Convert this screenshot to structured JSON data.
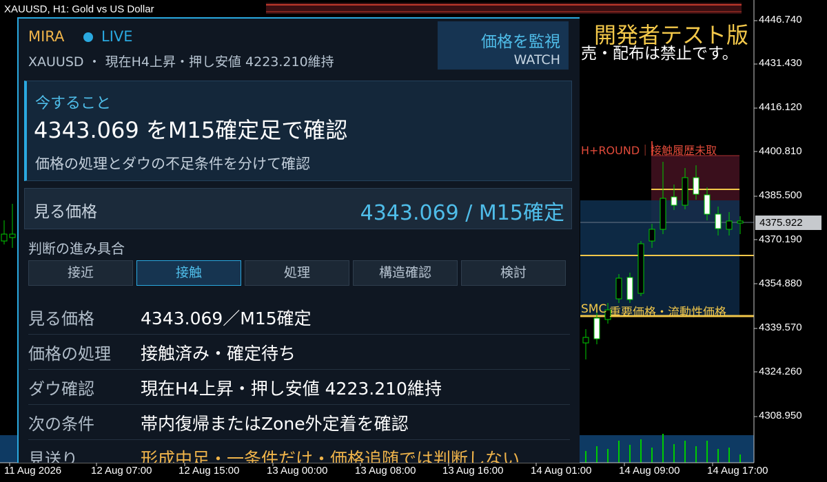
{
  "window": {
    "symbol_title": "XAUUSD, H1:  Gold vs US Dollar"
  },
  "chart": {
    "price_labels": [
      "4446.740",
      "4431.430",
      "4416.120",
      "4400.810",
      "4385.500",
      "4370.190",
      "4354.880",
      "4339.570",
      "4324.260",
      "4308.950"
    ],
    "current_price": "4375.922",
    "time_labels": [
      "11 Aug 2026",
      "12 Aug 07:00",
      "12 Aug 15:00",
      "13 Aug 00:00",
      "13 Aug 08:00",
      "13 Aug 16:00",
      "14 Aug 01:00",
      "14 Aug 09:00",
      "14 Aug 17:00"
    ],
    "dev_banner": "開発者テスト版",
    "dev_notice": "売・配布は禁止です。",
    "round_label": "H+ROUND｜接触履歴未取",
    "smc_label": "SMC",
    "liquidity_label": "重要価格・流動性価格",
    "colors": {
      "bull": "#00cc00",
      "candle_body": "#ffffff",
      "level": "#f3c84a",
      "zone": "#0f3050"
    }
  },
  "panel": {
    "brand": "MIRA",
    "status": "LIVE",
    "subtitle": "XAUUSD ・ 現在H4上昇・押し安値 4223.210維持",
    "watch_button": {
      "jp": "価格を監視",
      "en": "WATCH"
    },
    "todo": {
      "label": "今すること",
      "main": "4343.069 をM15確定足で確認",
      "sub": "価格の処理とダウの不足条件を分けて確認"
    },
    "watch_price": {
      "label": "見る価格",
      "value": "4343.069 / M15確定"
    },
    "progress": {
      "title": "判断の進み具合",
      "steps": [
        "接近",
        "接触",
        "処理",
        "構造確認",
        "検討"
      ],
      "active": "接触"
    },
    "rows": [
      {
        "key": "見る価格",
        "value": "4343.069／M15確定"
      },
      {
        "key": "価格の処理",
        "value": "接触済み・確定待ち"
      },
      {
        "key": "ダウ確認",
        "value": "現在H4上昇・押し安値 4223.210維持"
      },
      {
        "key": "次の条件",
        "value": "帯内復帰またはZone外定着を確認"
      },
      {
        "key": "見送り",
        "value": "形成中足・一条件だけ・価格追随では判断しない"
      }
    ],
    "colors": {
      "accent": "#2aa9e0",
      "brand": "#f0b44a",
      "warn": "#f0b44a"
    }
  }
}
